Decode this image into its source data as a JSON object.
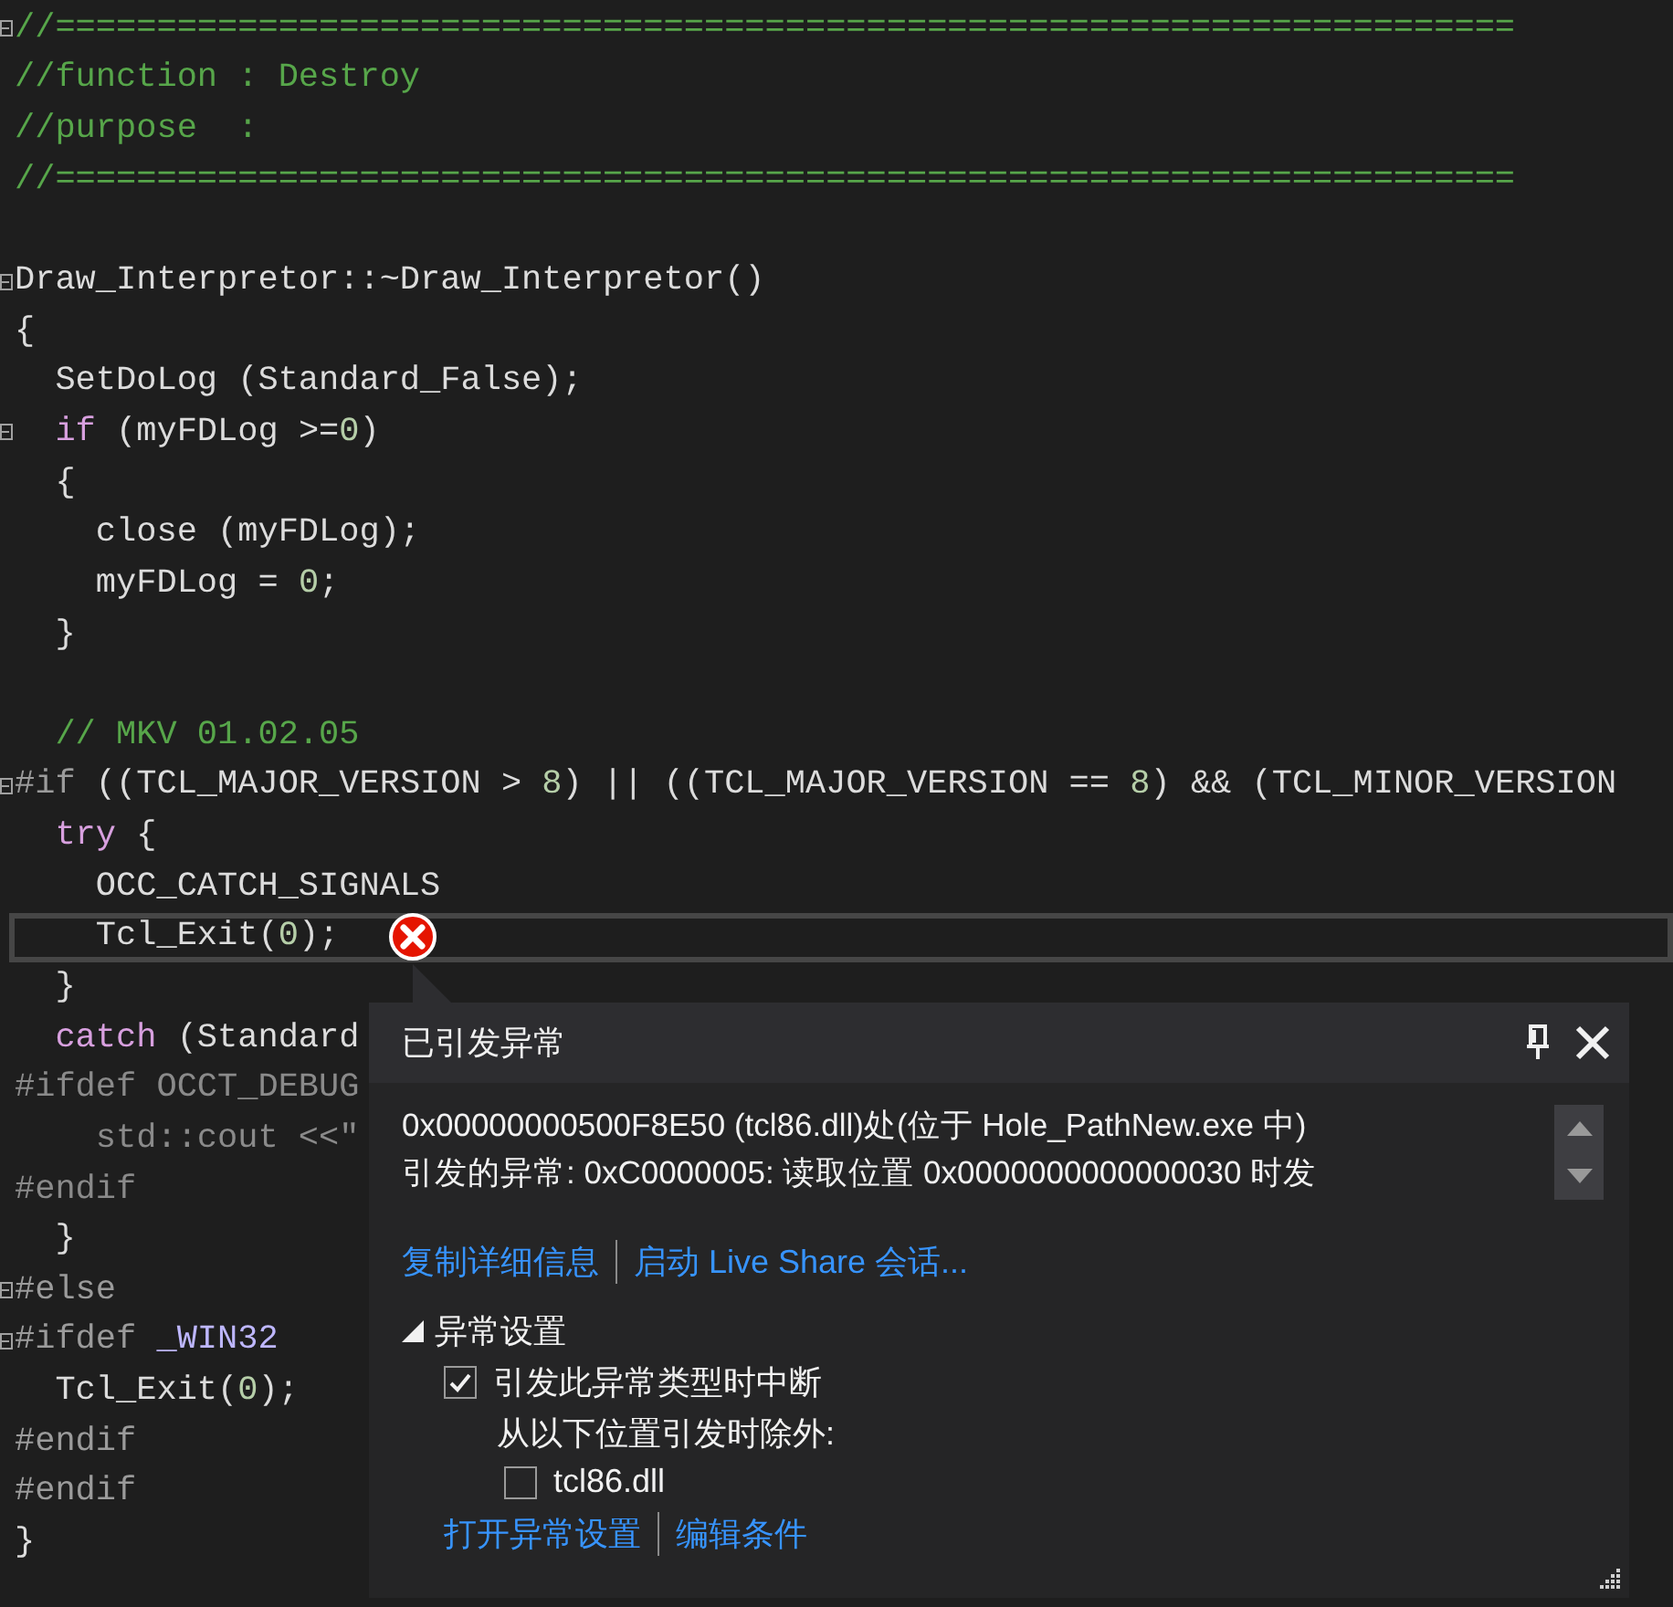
{
  "editor": {
    "lines": [
      {
        "fold": true,
        "current": false,
        "error": false,
        "tokens": [
          {
            "kind": "comment",
            "text": "//========================================================================"
          }
        ]
      },
      {
        "fold": false,
        "current": false,
        "error": false,
        "tokens": [
          {
            "kind": "comment",
            "text": "//function : Destroy"
          }
        ]
      },
      {
        "fold": false,
        "current": false,
        "error": false,
        "tokens": [
          {
            "kind": "comment",
            "text": "//purpose  :"
          }
        ]
      },
      {
        "fold": false,
        "current": false,
        "error": false,
        "tokens": [
          {
            "kind": "comment",
            "text": "//========================================================================"
          }
        ]
      },
      {
        "fold": false,
        "current": false,
        "error": false
      },
      {
        "fold": true,
        "current": false,
        "error": false,
        "tokens": [
          {
            "kind": "text",
            "text": "Draw_Interpretor::~Draw_Interpretor()"
          }
        ]
      },
      {
        "fold": false,
        "current": false,
        "error": false,
        "tokens": [
          {
            "kind": "text",
            "text": "{"
          }
        ]
      },
      {
        "fold": false,
        "current": false,
        "error": false,
        "tokens": [
          {
            "kind": "text",
            "text": "  SetDoLog (Standard_False);"
          }
        ]
      },
      {
        "fold": true,
        "current": false,
        "error": false,
        "tokens": [
          {
            "kind": "keyword",
            "text": "  if"
          },
          {
            "kind": "text",
            "text": " (myFDLog >="
          },
          {
            "kind": "number",
            "text": "0"
          },
          {
            "kind": "text",
            "text": ")"
          }
        ]
      },
      {
        "fold": false,
        "current": false,
        "error": false,
        "tokens": [
          {
            "kind": "text",
            "text": "  {"
          }
        ]
      },
      {
        "fold": false,
        "current": false,
        "error": false,
        "tokens": [
          {
            "kind": "text",
            "text": "    close (myFDLog);"
          }
        ]
      },
      {
        "fold": false,
        "current": false,
        "error": false,
        "tokens": [
          {
            "kind": "text",
            "text": "    myFDLog = "
          },
          {
            "kind": "number",
            "text": "0"
          },
          {
            "kind": "text",
            "text": ";"
          }
        ]
      },
      {
        "fold": false,
        "current": false,
        "error": false,
        "tokens": [
          {
            "kind": "text",
            "text": "  }"
          }
        ]
      },
      {
        "fold": false,
        "current": false,
        "error": false
      },
      {
        "fold": false,
        "current": false,
        "error": false,
        "tokens": [
          {
            "kind": "comment",
            "text": "  // MKV 01.02.05"
          }
        ]
      },
      {
        "fold": true,
        "current": false,
        "error": false,
        "tokens": [
          {
            "kind": "preproc",
            "text": "#if"
          },
          {
            "kind": "text",
            "text": " ((TCL_MAJOR_VERSION > "
          },
          {
            "kind": "number",
            "text": "8"
          },
          {
            "kind": "text",
            "text": ") || ((TCL_MAJOR_VERSION == "
          },
          {
            "kind": "number",
            "text": "8"
          },
          {
            "kind": "text",
            "text": ") && (TCL_MINOR_VERSION"
          }
        ]
      },
      {
        "fold": false,
        "current": false,
        "error": false,
        "tokens": [
          {
            "kind": "keyword",
            "text": "  try"
          },
          {
            "kind": "text",
            "text": " {"
          }
        ]
      },
      {
        "fold": false,
        "current": false,
        "error": false,
        "tokens": [
          {
            "kind": "text",
            "text": "    OCC_CATCH_SIGNALS"
          }
        ]
      },
      {
        "fold": false,
        "current": true,
        "error": true,
        "tokens": [
          {
            "kind": "text",
            "text": "    Tcl_Exit("
          },
          {
            "kind": "number",
            "text": "0"
          },
          {
            "kind": "text",
            "text": ");"
          }
        ]
      },
      {
        "fold": false,
        "current": false,
        "error": false,
        "tokens": [
          {
            "kind": "text",
            "text": "  }"
          }
        ]
      },
      {
        "fold": false,
        "current": false,
        "error": false,
        "tokens": [
          {
            "kind": "keyword",
            "text": "  catch"
          },
          {
            "kind": "text",
            "text": " (Standard"
          }
        ]
      },
      {
        "fold": false,
        "current": false,
        "error": false,
        "tokens": [
          {
            "kind": "inactive",
            "text": "#ifdef OCCT_DEBUG"
          }
        ]
      },
      {
        "fold": false,
        "current": false,
        "error": false,
        "tokens": [
          {
            "kind": "inactive",
            "text": "    std::cout <<\""
          }
        ]
      },
      {
        "fold": false,
        "current": false,
        "error": false,
        "tokens": [
          {
            "kind": "inactive",
            "text": "#endif"
          }
        ]
      },
      {
        "fold": false,
        "current": false,
        "error": false,
        "tokens": [
          {
            "kind": "text",
            "text": "  }"
          }
        ]
      },
      {
        "fold": true,
        "current": false,
        "error": false,
        "tokens": [
          {
            "kind": "preproc",
            "text": "#else"
          }
        ]
      },
      {
        "fold": true,
        "current": false,
        "error": false,
        "tokens": [
          {
            "kind": "preproc",
            "text": "#ifdef "
          },
          {
            "kind": "macro",
            "text": "_WIN32"
          }
        ]
      },
      {
        "fold": false,
        "current": false,
        "error": false,
        "tokens": [
          {
            "kind": "text",
            "text": "  Tcl_Exit("
          },
          {
            "kind": "number",
            "text": "0"
          },
          {
            "kind": "text",
            "text": ");"
          }
        ]
      },
      {
        "fold": false,
        "current": false,
        "error": false,
        "tokens": [
          {
            "kind": "preproc",
            "text": "#endif"
          }
        ]
      },
      {
        "fold": false,
        "current": false,
        "error": false,
        "tokens": [
          {
            "kind": "preproc",
            "text": "#endif"
          }
        ]
      },
      {
        "fold": false,
        "current": false,
        "error": false,
        "tokens": [
          {
            "kind": "text",
            "text": "}"
          }
        ]
      }
    ]
  },
  "exception_popup": {
    "title": "已引发异常",
    "message": [
      "0x00000000500F8E50 (tcl86.dll)处(位于 Hole_PathNew.exe 中)",
      "引发的异常: 0xC0000005: 读取位置 0x0000000000000030 时发"
    ],
    "links": [
      "复制详细信息",
      "启动 Live Share 会话..."
    ],
    "settings": {
      "label": "异常设置",
      "expanded": true,
      "break_option": {
        "label": "引发此异常类型时中断",
        "checked": true
      },
      "except_label": "从以下位置引发时除外:",
      "modules": [
        {
          "label": "tcl86.dll",
          "checked": false
        }
      ],
      "links": [
        "打开异常设置",
        "编辑条件"
      ]
    }
  }
}
